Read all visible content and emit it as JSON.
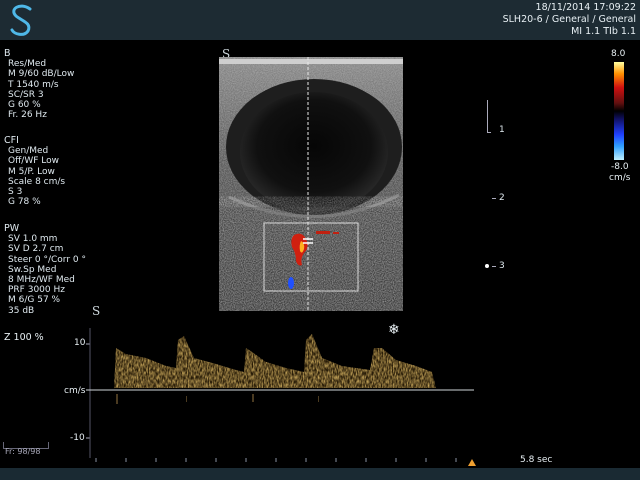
{
  "header": {
    "datetime": "18/11/2014 17:09:22",
    "preset": "SLH20-6 / General / General",
    "indices": "MI 1.1  TIb  1.1"
  },
  "b_mode": {
    "title": "B",
    "lines": [
      "Res/Med",
      "M 9/60 dB/Low",
      "T 1540 m/s",
      "SC/SR 3",
      "G 60 %",
      "Fr. 26 Hz"
    ]
  },
  "cfi": {
    "title": "CFI",
    "lines": [
      "Gen/Med",
      "Off/WF Low",
      "M 5/P. Low",
      "Scale 8 cm/s",
      "S 3",
      "G 78 %"
    ]
  },
  "pw": {
    "title": "PW",
    "lines": [
      "SV 1.0 mm",
      "SV D 2.7 cm",
      "Steer 0 °/Corr 0 °",
      "Sw.Sp Med",
      "8 MHz/WF Med",
      "PRF 3000 Hz",
      "M 6/G 57 %",
      "35 dB"
    ]
  },
  "depth_scale": [
    "1",
    "2",
    "3"
  ],
  "colorbar": {
    "top": "8.0",
    "bottom": "-8.0",
    "unit": "cm/s"
  },
  "doppler": {
    "zoom": "Z  100  %",
    "y_top": "10",
    "y_unit": "cm/s",
    "y_bottom": "-10",
    "time": "5.8 sec",
    "frame": "Fr: 98/98"
  }
}
